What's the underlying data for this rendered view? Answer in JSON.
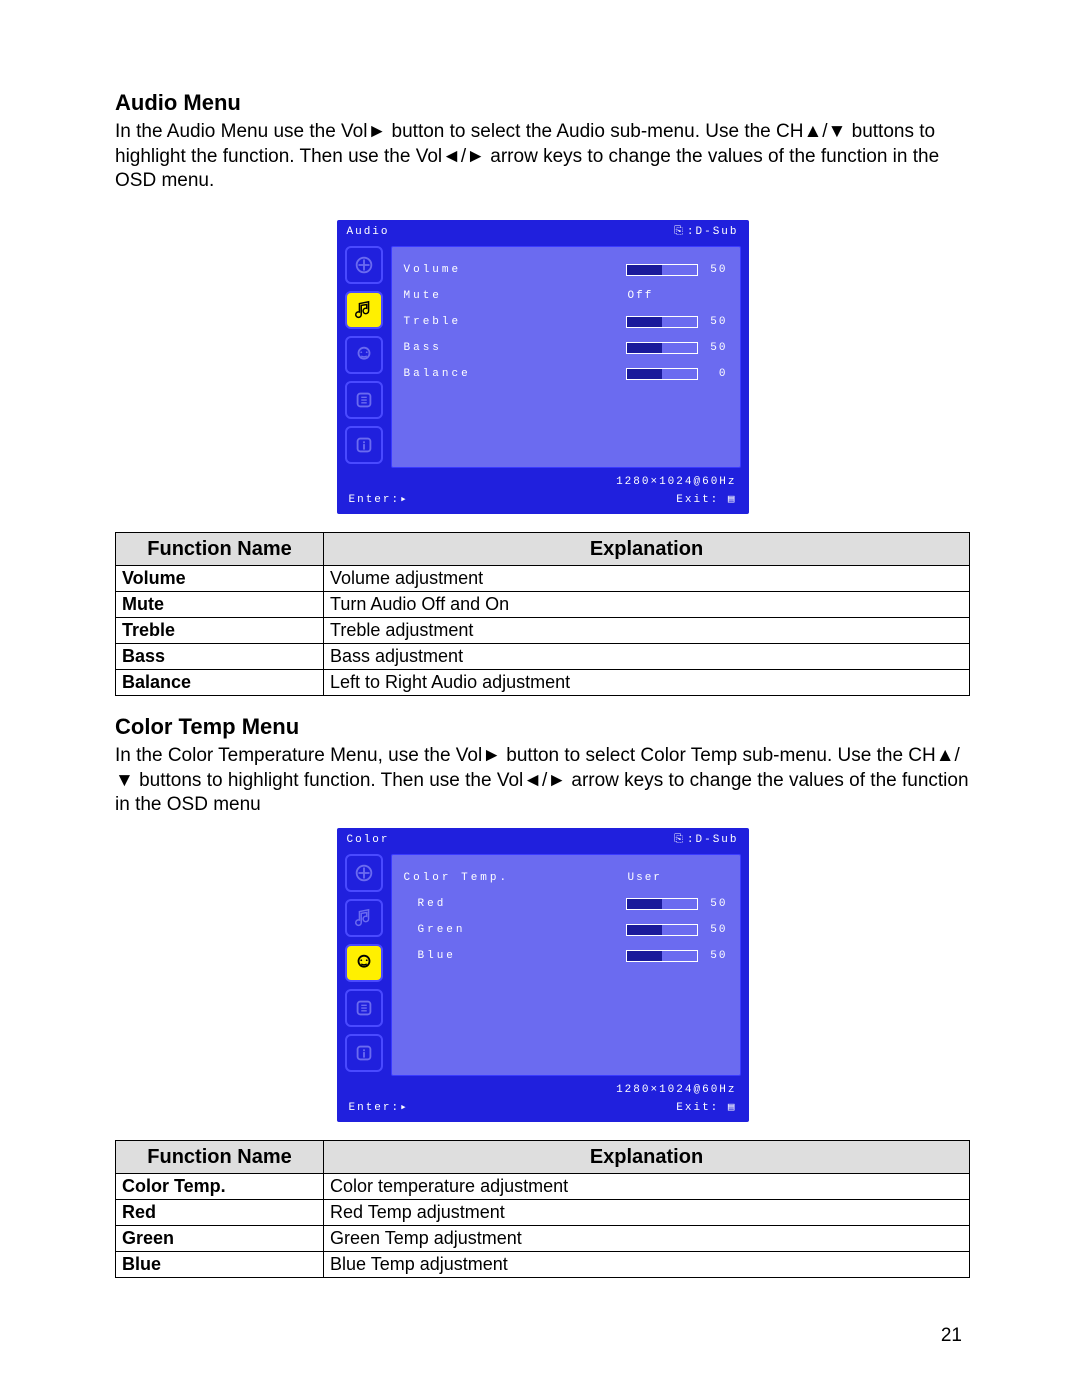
{
  "page_number": "21",
  "section1": {
    "heading": "Audio Menu",
    "para": "In the Audio Menu use the Vol► button to select the Audio sub-menu. Use the CH▲/▼ buttons to highlight the function.    Then use the Vol◄/► arrow keys to change the values of the function in the OSD menu."
  },
  "section2": {
    "heading": "Color Temp Menu",
    "para": "In the Color Temperature Menu, use the Vol► button to select Color Temp sub-menu. Use the CH▲/▼ buttons to highlight function.    Then use the Vol◄/► arrow keys to change the values of the function in the OSD menu"
  },
  "osd_common": {
    "input_label": ":D-Sub",
    "resolution": "1280×1024@60Hz",
    "enter": "Enter:▸",
    "exit": "Exit: ▤"
  },
  "osd_audio": {
    "title": "Audio",
    "items": {
      "volume": {
        "label": "Volume",
        "value": "50",
        "fill_pct": 50
      },
      "mute": {
        "label": "Mute",
        "value": "Off"
      },
      "treble": {
        "label": "Treble",
        "value": "50",
        "fill_pct": 50
      },
      "bass": {
        "label": "Bass",
        "value": "50",
        "fill_pct": 50
      },
      "balance": {
        "label": "Balance",
        "value": "0",
        "fill_pct": 50
      }
    }
  },
  "osd_color": {
    "title": "Color",
    "items": {
      "ct": {
        "label": "Color Temp.",
        "value": "User"
      },
      "red": {
        "label": "Red",
        "value": "50",
        "fill_pct": 50
      },
      "green": {
        "label": "Green",
        "value": "50",
        "fill_pct": 50
      },
      "blue": {
        "label": "Blue",
        "value": "50",
        "fill_pct": 50
      }
    }
  },
  "table_headers": {
    "fn": "Function Name",
    "ex": "Explanation"
  },
  "table1": {
    "rows": {
      "r0": {
        "fn": "Volume",
        "ex": "Volume adjustment"
      },
      "r1": {
        "fn": "Mute",
        "ex": "Turn Audio Off and On"
      },
      "r2": {
        "fn": "Treble",
        "ex": "Treble adjustment"
      },
      "r3": {
        "fn": "Bass",
        "ex": "Bass adjustment"
      },
      "r4": {
        "fn": "Balance",
        "ex": "Left to Right Audio adjustment"
      }
    }
  },
  "table2": {
    "rows": {
      "r0": {
        "fn": "Color Temp.",
        "ex": "Color temperature adjustment"
      },
      "r1": {
        "fn": "Red",
        "ex": "Red Temp adjustment"
      },
      "r2": {
        "fn": "Green",
        "ex": "Green Temp adjustment"
      },
      "r3": {
        "fn": "Blue",
        "ex": "Blue Temp adjustment"
      }
    }
  }
}
